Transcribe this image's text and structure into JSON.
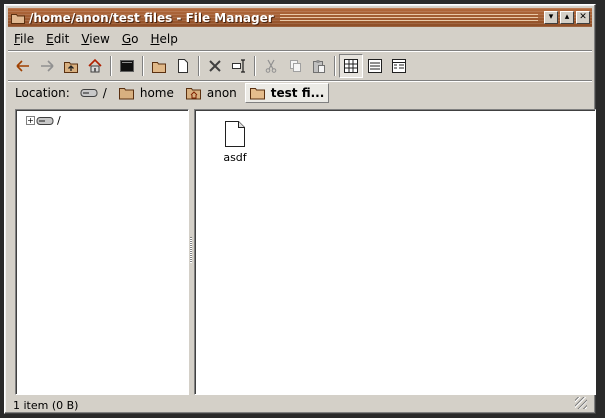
{
  "window": {
    "title": "/home/anon/test files - File Manager"
  },
  "titlebar_buttons": {
    "minimize": "▾",
    "maximize": "▴",
    "close": "✕"
  },
  "menu": [
    {
      "label": "File",
      "key": "F",
      "rest": "ile"
    },
    {
      "label": "Edit",
      "key": "E",
      "rest": "dit"
    },
    {
      "label": "View",
      "key": "V",
      "rest": "iew"
    },
    {
      "label": "Go",
      "key": "G",
      "rest": "o"
    },
    {
      "label": "Help",
      "key": "H",
      "rest": "elp"
    }
  ],
  "location": {
    "label": "Location:",
    "crumbs": [
      "/",
      "home",
      "anon",
      "test fi..."
    ]
  },
  "tree": {
    "root_label": "/"
  },
  "files": [
    {
      "name": "asdf"
    }
  ],
  "status": {
    "text": "1 item (0 B)"
  },
  "colors": {
    "titlebar": "#9c5a30",
    "face": "#d4d0c8",
    "folder": "#c8a070"
  }
}
